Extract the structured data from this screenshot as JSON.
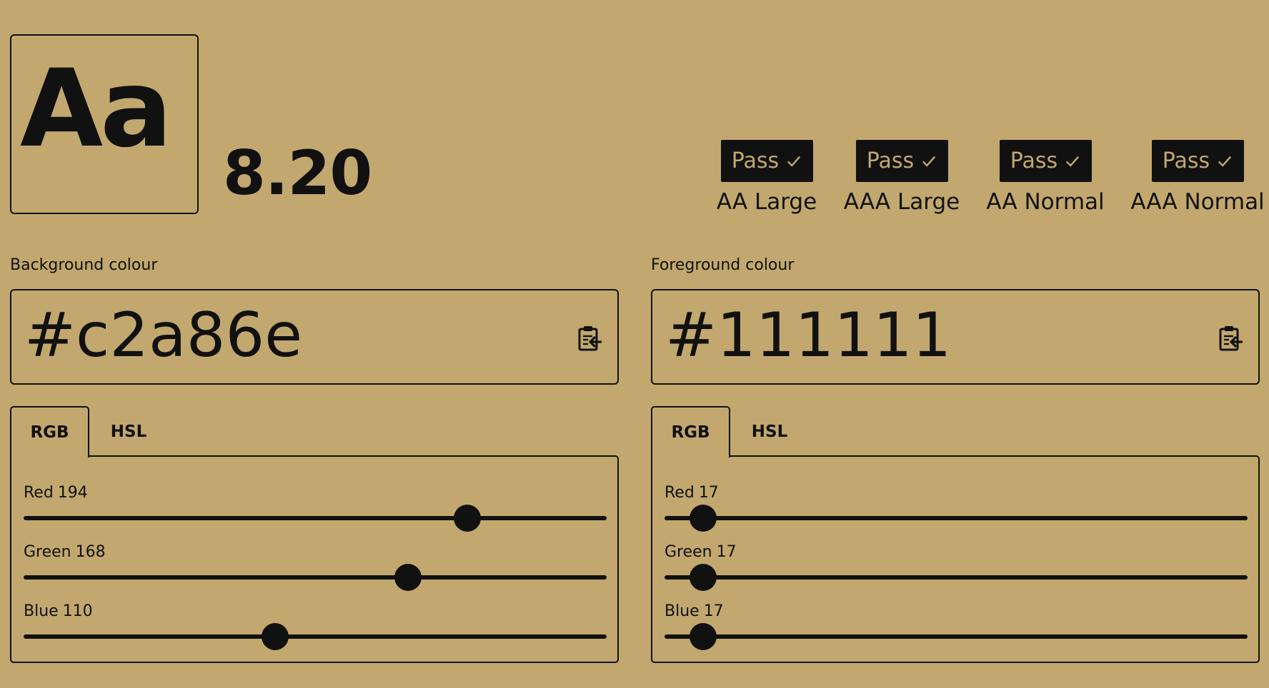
{
  "preview": {
    "sample_text": "Aa"
  },
  "contrast": {
    "ratio": "8.20"
  },
  "badges": [
    {
      "status": "Pass",
      "label": "AA Large"
    },
    {
      "status": "Pass",
      "label": "AAA Large"
    },
    {
      "status": "Pass",
      "label": "AA Normal"
    },
    {
      "status": "Pass",
      "label": "AAA Normal"
    }
  ],
  "background": {
    "label": "Background colour",
    "hex": "#c2a86e",
    "paste_icon": "clipboard-paste-icon",
    "tabs": [
      {
        "label": "RGB",
        "active": true
      },
      {
        "label": "HSL",
        "active": false
      }
    ],
    "sliders": [
      {
        "name": "Red",
        "value": "194",
        "level": 0.7608
      },
      {
        "name": "Green",
        "value": "168",
        "level": 0.6588
      },
      {
        "name": "Blue",
        "value": "110",
        "level": 0.4314
      }
    ]
  },
  "foreground": {
    "label": "Foreground colour",
    "hex": "#111111",
    "paste_icon": "clipboard-paste-icon",
    "tabs": [
      {
        "label": "RGB",
        "active": true
      },
      {
        "label": "HSL",
        "active": false
      }
    ],
    "sliders": [
      {
        "name": "Red",
        "value": "17",
        "level": 0.0667
      },
      {
        "name": "Green",
        "value": "17",
        "level": 0.0667
      },
      {
        "name": "Blue",
        "value": "17",
        "level": 0.0667
      }
    ]
  },
  "colors": {
    "background": "#c2a86e",
    "foreground": "#111111"
  }
}
